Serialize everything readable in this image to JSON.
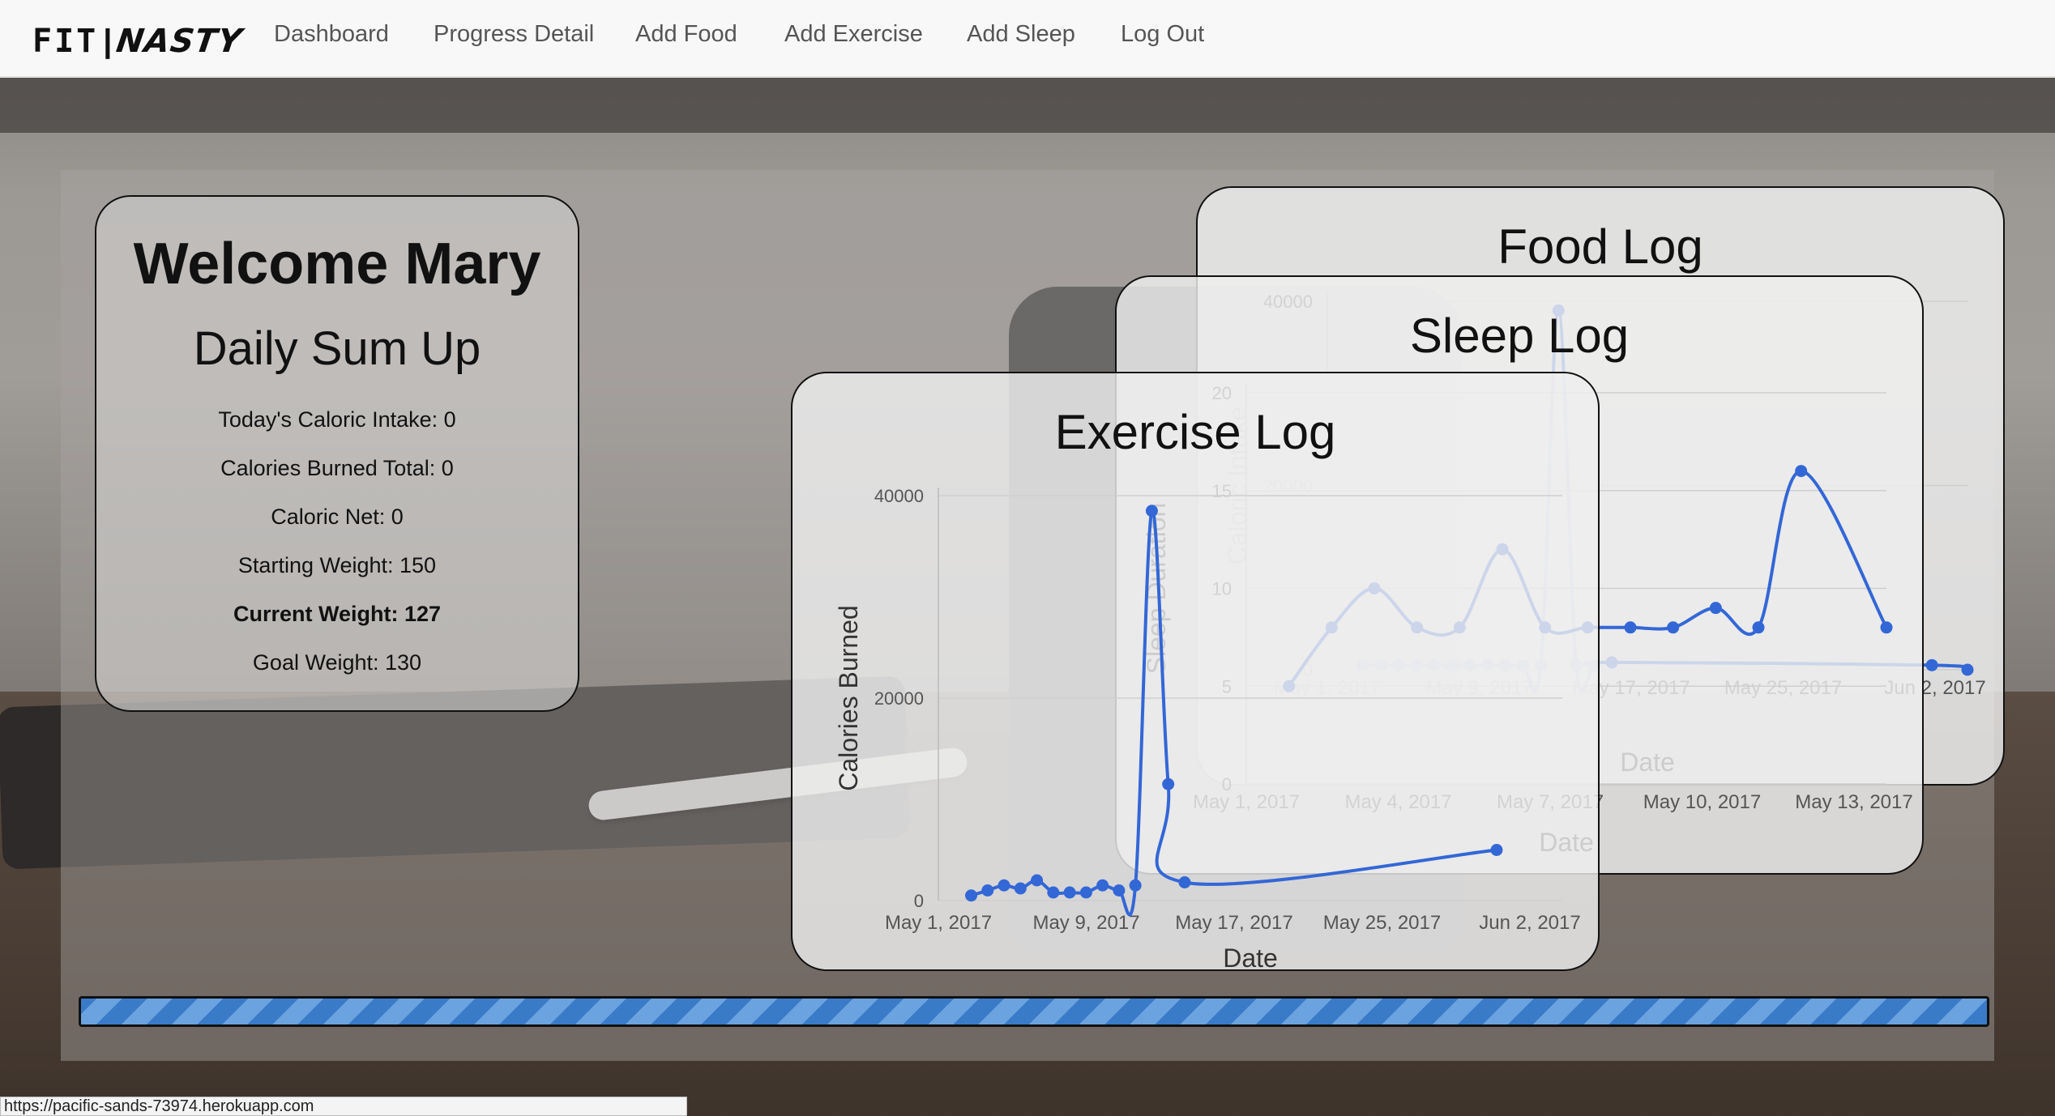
{
  "nav": {
    "brand_fit": "FIT",
    "brand_sep": "|",
    "brand_nasty": "NASTY",
    "links": [
      "Dashboard",
      "Progress Detail",
      "Add Food",
      "Add Exercise",
      "Add Sleep",
      "Log Out"
    ]
  },
  "welcome": {
    "title": "Welcome Mary",
    "subtitle": "Daily Sum Up",
    "stats": [
      "Today's Caloric Intake: 0",
      "Calories Burned Total: 0",
      "Caloric Net: 0",
      "Starting Weight: 150",
      "Current Weight: 127",
      "Goal Weight: 130"
    ]
  },
  "logs": {
    "food_title": "Food Log",
    "sleep_title": "Sleep Log",
    "exercise_title": "Exercise Log"
  },
  "progress": {
    "value": 1.0
  },
  "status_url": "https://pacific-sands-73974.herokuapp.com",
  "colors": {
    "series": "#3367d6",
    "navbar": "#f8f8f8",
    "progress": "#3a7bc8"
  },
  "chart_data": [
    {
      "name": "food",
      "type": "line",
      "ylabel": "Caloric Intake",
      "xlabel": "Date",
      "ylim": [
        0,
        40000
      ],
      "yticks": [
        "0",
        "20000",
        "40000"
      ],
      "xticks": [
        "May 1, 2017",
        "May 9, 2017",
        "May 17, 2017",
        "May 25, 2017",
        "Jun 2, 2017"
      ],
      "xlim": [
        "2017-04-29",
        "2017-06-04"
      ],
      "points": [
        {
          "x": "2017-05-01",
          "y": 500
        },
        {
          "x": "2017-05-02",
          "y": 500
        },
        {
          "x": "2017-05-03",
          "y": 500
        },
        {
          "x": "2017-05-04",
          "y": 450
        },
        {
          "x": "2017-05-05",
          "y": 500
        },
        {
          "x": "2017-05-06",
          "y": 450
        },
        {
          "x": "2017-05-07",
          "y": 500
        },
        {
          "x": "2017-05-08",
          "y": 500
        },
        {
          "x": "2017-05-09",
          "y": 450
        },
        {
          "x": "2017-05-10",
          "y": 500
        },
        {
          "x": "2017-05-11",
          "y": 500
        },
        {
          "x": "2017-05-12",
          "y": 39000
        },
        {
          "x": "2017-05-13",
          "y": 500
        },
        {
          "x": "2017-05-14",
          "y": 400
        },
        {
          "x": "2017-05-15",
          "y": 800
        },
        {
          "x": "2017-06-02",
          "y": 500
        },
        {
          "x": "2017-06-04",
          "y": 0
        }
      ]
    },
    {
      "name": "sleep",
      "type": "line",
      "ylabel": "Sleep Duration",
      "xlabel": "Date",
      "ylim": [
        0,
        20
      ],
      "yticks": [
        "0",
        "5",
        "10",
        "15",
        "20"
      ],
      "xticks": [
        "May 1, 2017",
        "May 4, 2017",
        "May 7, 2017",
        "May 10, 2017",
        "May 13, 2017"
      ],
      "xlim": [
        "2017-04-30",
        "2017-05-15"
      ],
      "points": [
        {
          "x": "2017-05-01",
          "y": 5
        },
        {
          "x": "2017-05-02",
          "y": 8
        },
        {
          "x": "2017-05-03",
          "y": 10
        },
        {
          "x": "2017-05-04",
          "y": 8
        },
        {
          "x": "2017-05-05",
          "y": 8
        },
        {
          "x": "2017-05-06",
          "y": 12
        },
        {
          "x": "2017-05-07",
          "y": 8
        },
        {
          "x": "2017-05-08",
          "y": 8
        },
        {
          "x": "2017-05-09",
          "y": 8
        },
        {
          "x": "2017-05-10",
          "y": 8
        },
        {
          "x": "2017-05-11",
          "y": 9
        },
        {
          "x": "2017-05-12",
          "y": 8
        },
        {
          "x": "2017-05-13",
          "y": 16
        },
        {
          "x": "2017-05-15",
          "y": 8
        }
      ]
    },
    {
      "name": "exercise",
      "type": "line",
      "ylabel": "Calories Burned",
      "xlabel": "Date",
      "ylim": [
        0,
        40000
      ],
      "yticks": [
        "0",
        "20000",
        "40000"
      ],
      "xticks": [
        "May 1, 2017",
        "May 9, 2017",
        "May 17, 2017",
        "May 25, 2017",
        "Jun 2, 2017"
      ],
      "xlim": [
        "2017-04-29",
        "2017-06-06"
      ],
      "points": [
        {
          "x": "2017-05-01",
          "y": 500
        },
        {
          "x": "2017-05-02",
          "y": 1000
        },
        {
          "x": "2017-05-03",
          "y": 1500
        },
        {
          "x": "2017-05-04",
          "y": 1200
        },
        {
          "x": "2017-05-05",
          "y": 2000
        },
        {
          "x": "2017-05-06",
          "y": 800
        },
        {
          "x": "2017-05-07",
          "y": 800
        },
        {
          "x": "2017-05-08",
          "y": 800
        },
        {
          "x": "2017-05-09",
          "y": 1500
        },
        {
          "x": "2017-05-10",
          "y": 1000
        },
        {
          "x": "2017-05-11",
          "y": 1500
        },
        {
          "x": "2017-05-12",
          "y": 38500
        },
        {
          "x": "2017-05-13",
          "y": 11500
        },
        {
          "x": "2017-05-14",
          "y": 1800
        },
        {
          "x": "2017-06-02",
          "y": 5000
        }
      ]
    }
  ]
}
